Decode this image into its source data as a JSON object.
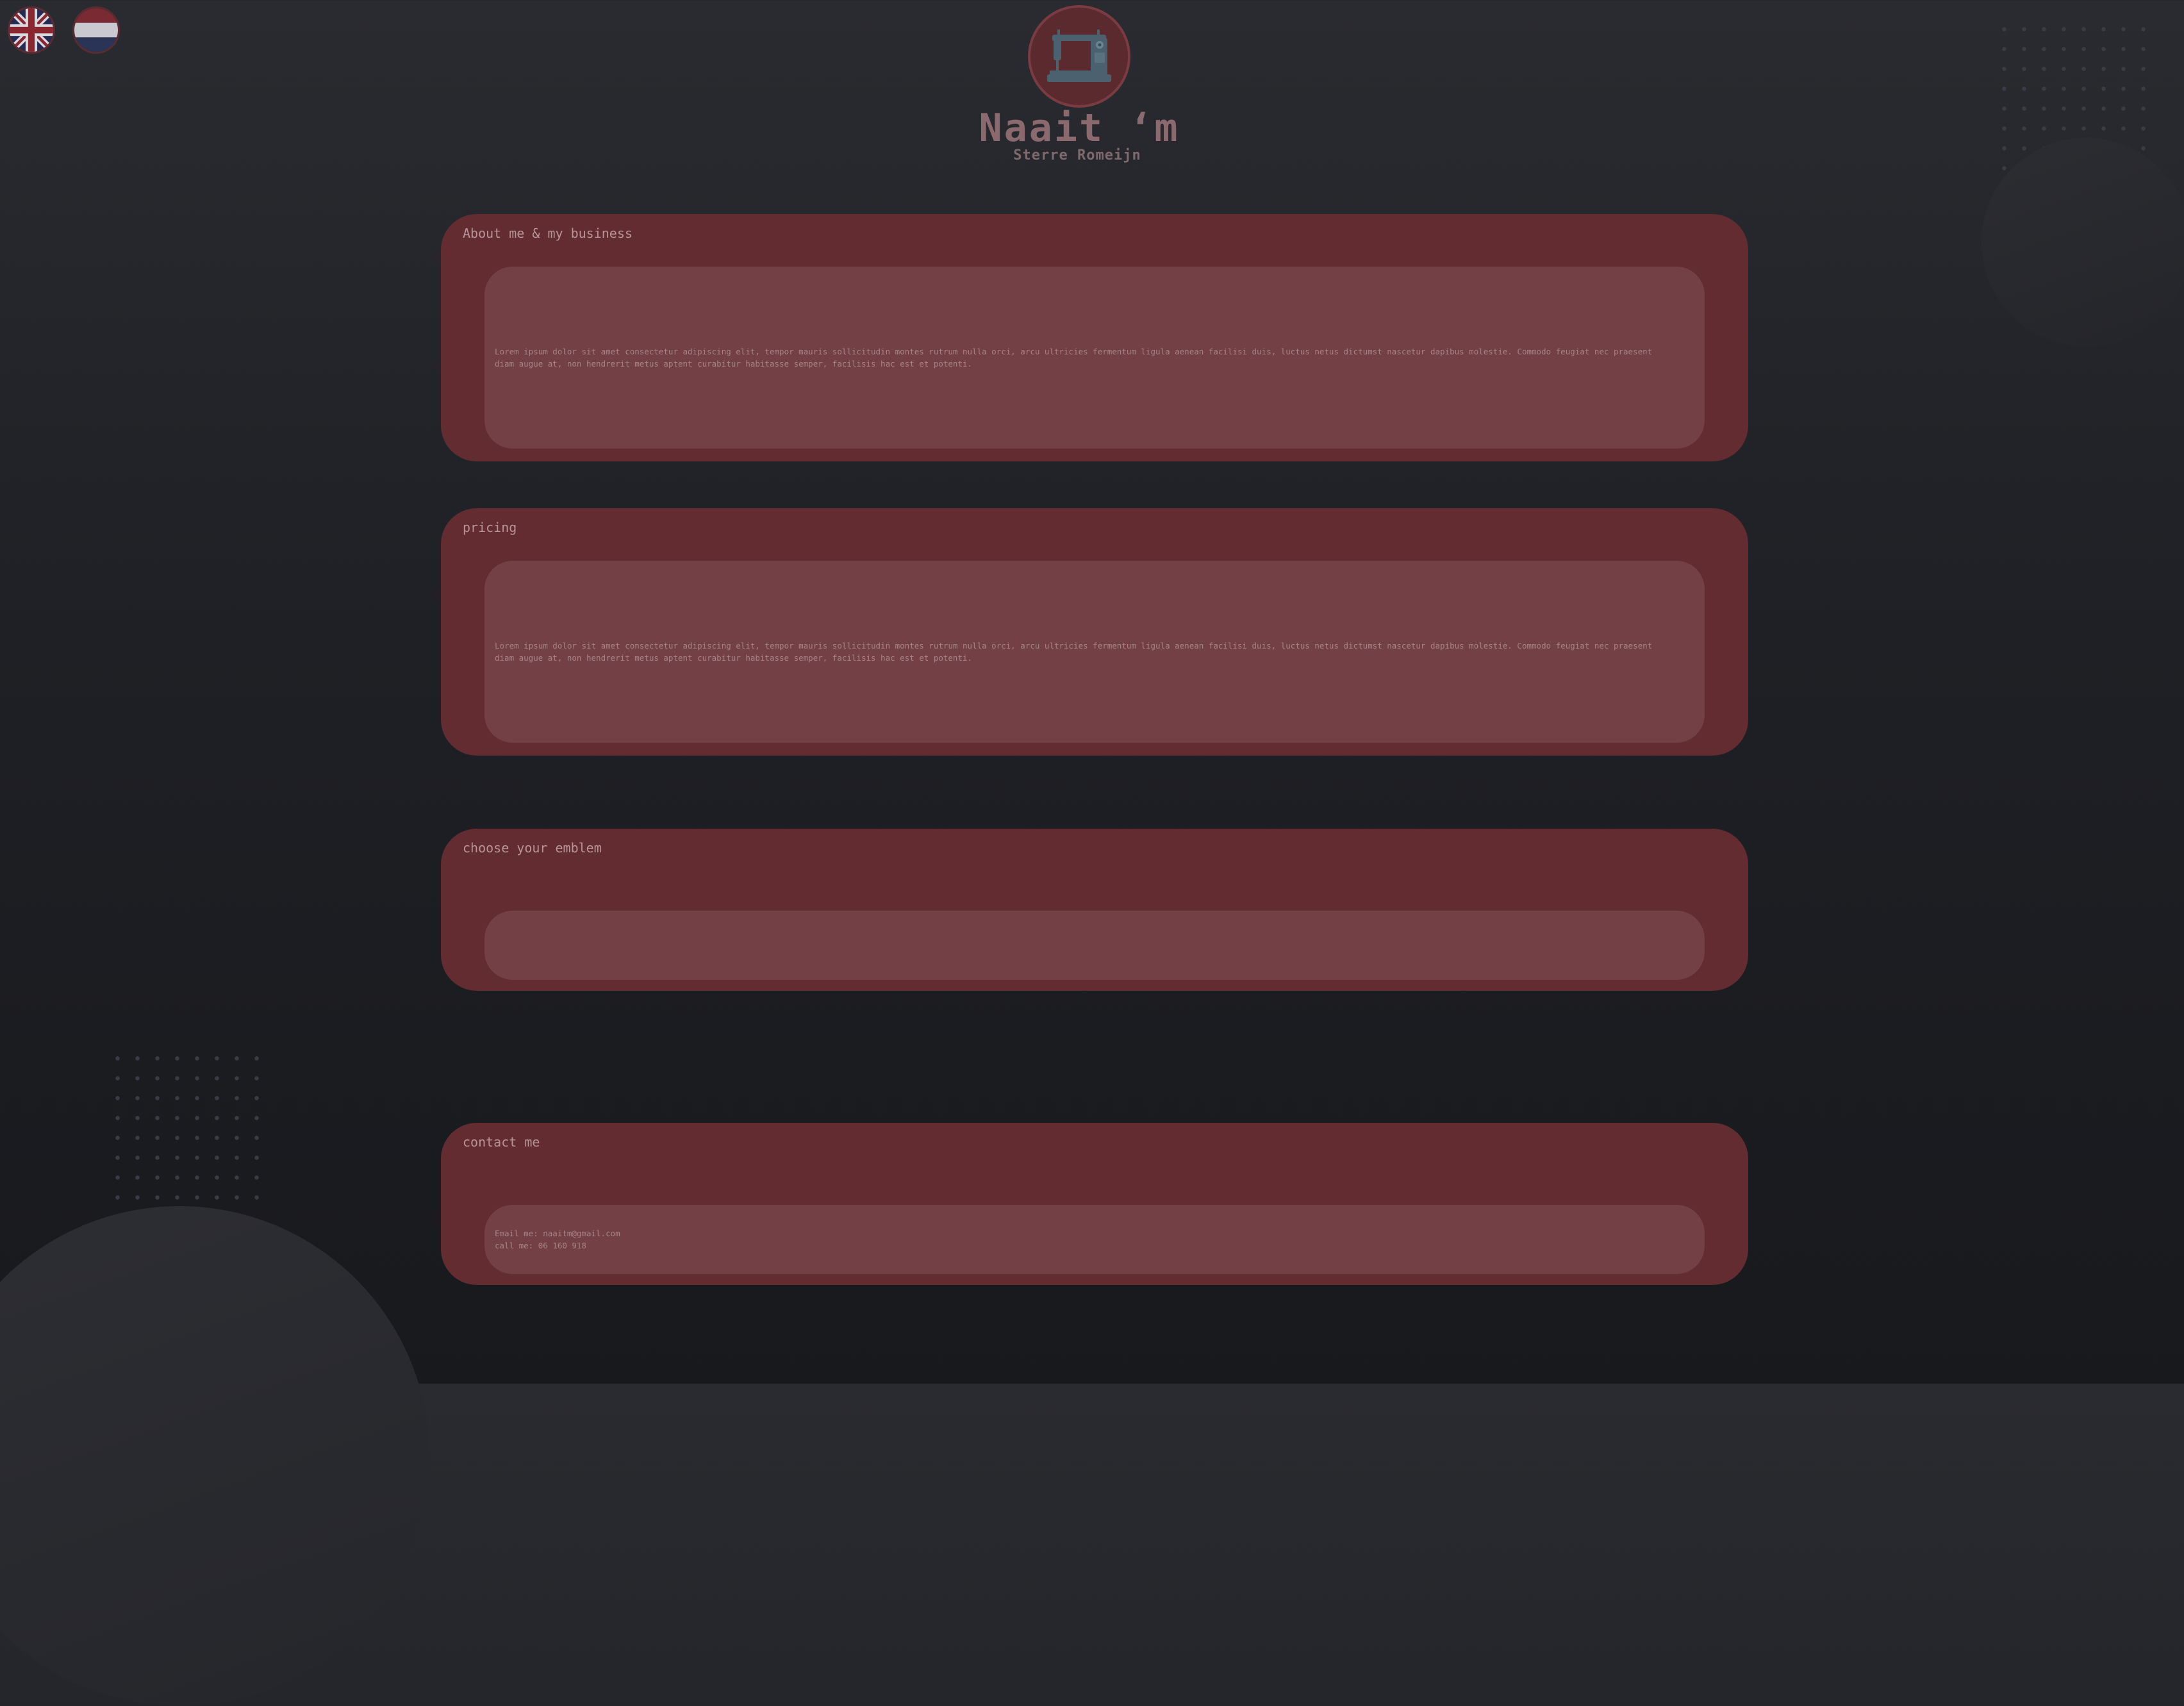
{
  "flags": [
    {
      "name": "English",
      "icon": "uk-flag-icon"
    },
    {
      "name": "Dutch",
      "icon": "nl-flag-icon"
    }
  ],
  "header": {
    "logo_icon": "sewing-machine-icon",
    "title": "Naait ‘m",
    "subtitle": "Sterre Romeijn"
  },
  "sections": {
    "about": {
      "title": "About me & my business",
      "text": "Lorem ipsum dolor sit amet consectetur adipiscing elit, tempor mauris sollicitudin montes rutrum nulla orci, arcu ultricies fermentum ligula aenean facilisi duis, luctus netus dictumst nascetur dapibus molestie. Commodo feugiat nec praesent diam augue at, non hendrerit metus aptent curabitur habitasse semper, facilisis hac est et potenti."
    },
    "pricing": {
      "title": "pricing",
      "text": "Lorem ipsum dolor sit amet consectetur adipiscing elit, tempor mauris sollicitudin montes rutrum nulla orci, arcu ultricies fermentum ligula aenean facilisi duis, luctus netus dictumst nascetur dapibus molestie. Commodo feugiat nec praesent diam augue at, non hendrerit metus aptent curabitur habitasse semper, facilisis hac est et potenti."
    },
    "emblem": {
      "title": "choose your emblem"
    },
    "contact": {
      "title": "contact me",
      "email_line": "Email me: naaitm@gmail.com",
      "call_line": "call me: 06 160 918"
    }
  },
  "colors": {
    "background": "#1f2025",
    "card": "#622c31",
    "card_inner": "#734045",
    "title_text": "#8a6a6f"
  }
}
